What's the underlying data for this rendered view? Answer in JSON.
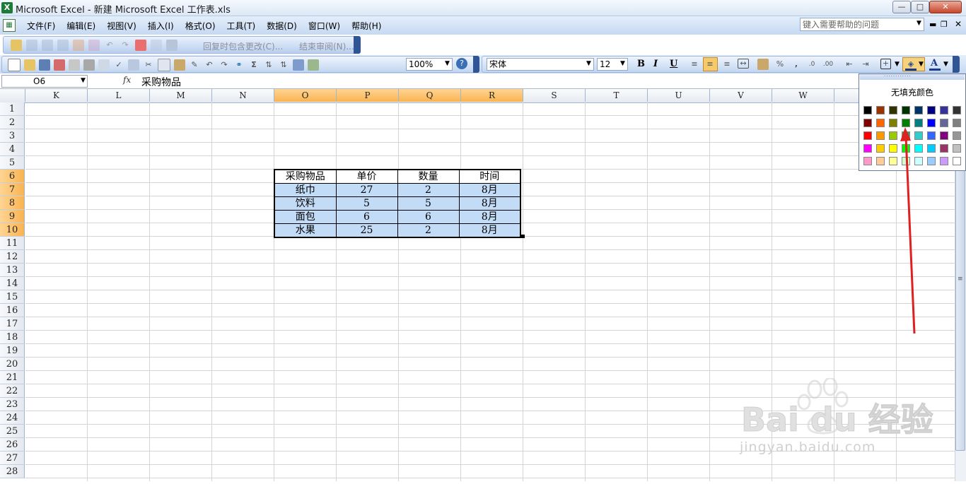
{
  "window": {
    "title": "Microsoft Excel - 新建 Microsoft Excel 工作表.xls"
  },
  "menu": {
    "items": [
      "文件(F)",
      "编辑(E)",
      "视图(V)",
      "插入(I)",
      "格式(O)",
      "工具(T)",
      "数据(D)",
      "窗口(W)",
      "帮助(H)"
    ],
    "help_placeholder": "键入需要帮助的问题"
  },
  "reviewing": {
    "reply_label": "回复时包含更改(C)...",
    "end_review": "结束审阅(N)..."
  },
  "standard": {
    "zoom": "100%"
  },
  "formatting": {
    "font": "宋体",
    "size": "12"
  },
  "formula_bar": {
    "cell_ref": "O6",
    "content": "采购物品"
  },
  "columns": [
    "K",
    "L",
    "M",
    "N",
    "O",
    "P",
    "Q",
    "R",
    "S",
    "T",
    "U",
    "V",
    "W"
  ],
  "selected_columns": [
    "O",
    "P",
    "Q",
    "R"
  ],
  "rows": [
    "1",
    "2",
    "3",
    "4",
    "5",
    "6",
    "7",
    "8",
    "9",
    "10",
    "11",
    "12",
    "13",
    "14",
    "15",
    "16",
    "17",
    "18",
    "19",
    "20",
    "21",
    "22",
    "23",
    "24",
    "25",
    "26",
    "27",
    "28"
  ],
  "selected_rows": [
    "6",
    "7",
    "8",
    "9",
    "10"
  ],
  "table": {
    "headers": [
      "采购物品",
      "单价",
      "数量",
      "时间"
    ],
    "rows": [
      [
        "纸巾",
        "27",
        "2",
        "8月"
      ],
      [
        "饮料",
        "5",
        "5",
        "8月"
      ],
      [
        "面包",
        "6",
        "6",
        "8月"
      ],
      [
        "水果",
        "25",
        "2",
        "8月"
      ]
    ],
    "selection_color": "#c2dcf7"
  },
  "fill_palette": {
    "no_fill_label": "无填充颜色",
    "colors": [
      "#000000",
      "#993300",
      "#333300",
      "#003300",
      "#003366",
      "#000080",
      "#333399",
      "#333333",
      "#800000",
      "#ff6600",
      "#808000",
      "#008000",
      "#008080",
      "#0000ff",
      "#666699",
      "#808080",
      "#ff0000",
      "#ff9900",
      "#99cc00",
      "#339966",
      "#33cccc",
      "#3366ff",
      "#800080",
      "#969696",
      "#ff00ff",
      "#ffcc00",
      "#ffff00",
      "#00ff00",
      "#00ffff",
      "#00ccff",
      "#993366",
      "#c0c0c0",
      "#ff99cc",
      "#ffcc99",
      "#ffff99",
      "#ccffcc",
      "#ccffff",
      "#99ccff",
      "#cc99ff",
      "#ffffff"
    ]
  },
  "annotation": {
    "arrow_color": "#e02020"
  },
  "watermark": {
    "brand": "Bai du 经验",
    "url": "jingyan.baidu.com"
  }
}
